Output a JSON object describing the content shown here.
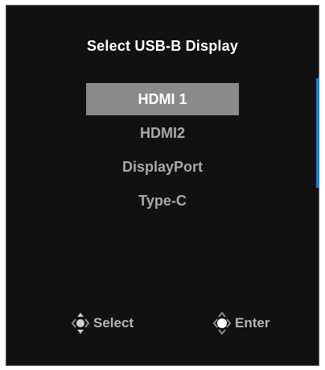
{
  "menu": {
    "title": "Select USB-B Display",
    "options": [
      {
        "label": "HDMI 1",
        "selected": true
      },
      {
        "label": "HDMI2",
        "selected": false
      },
      {
        "label": "DisplayPort",
        "selected": false
      },
      {
        "label": "Type-C",
        "selected": false
      }
    ]
  },
  "footer": {
    "select_label": "Select",
    "enter_label": "Enter",
    "select_icon": "joystick-updown-icon",
    "enter_icon": "joystick-press-icon"
  },
  "colors": {
    "background": "#111111",
    "selected_bg": "#8a8a8a",
    "text_inactive": "#a9a9a9",
    "accent": "#2b7bc6"
  }
}
